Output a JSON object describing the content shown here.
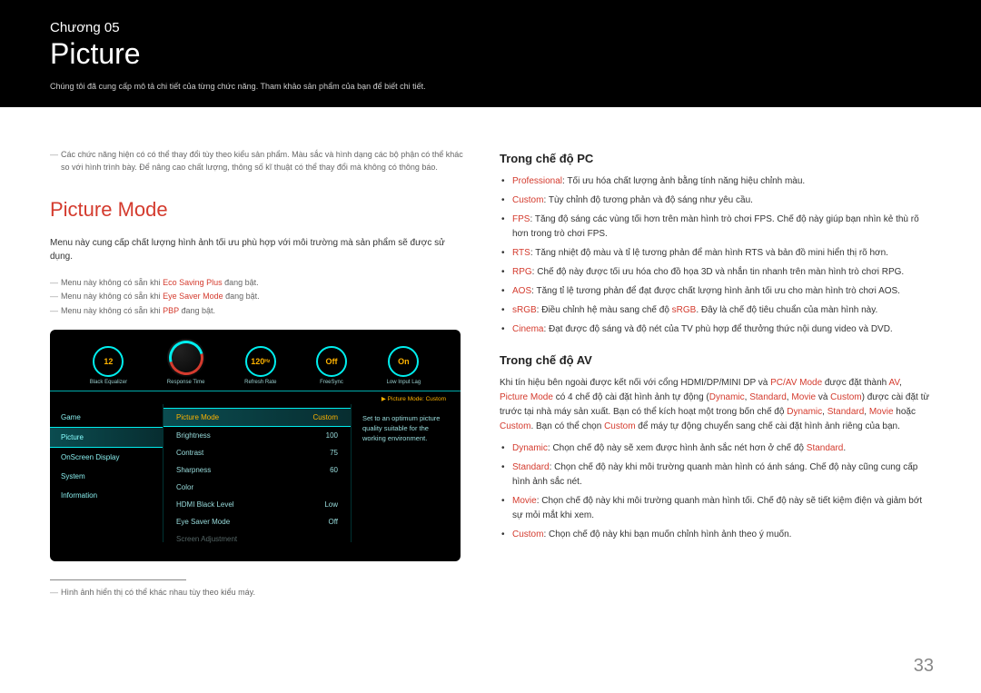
{
  "header": {
    "chapter": "Chương 05",
    "title": "Picture",
    "subtitle": "Chúng tôi đã cung cấp mô tả chi tiết của từng chức năng. Tham khảo sản phẩm của bạn để biết chi tiết."
  },
  "left": {
    "top_note_a": "Các chức năng hiện có có thể thay đổi tùy theo kiểu sản phẩm. Màu sắc và hình dạng các bộ phận có thể khác so với hình trình bày. Để nâng cao chất lượng, thông số kĩ thuật có thể thay đổi mà không có thông báo.",
    "section_title": "Picture Mode",
    "intro": "Menu này cung cấp chất lượng hình ảnh tối ưu phù hợp với môi trường mà sản phẩm sẽ được sử dụng.",
    "note1_a": "Menu này không có sẵn khi ",
    "note1_b": "Eco Saving Plus",
    "note1_c": " đang bật.",
    "note2_a": "Menu này không có sẵn khi ",
    "note2_b": "Eye Saver Mode",
    "note2_c": " đang bật.",
    "note3_a": "Menu này không có sẵn khi ",
    "note3_b": "PBP",
    "note3_c": " đang bật.",
    "footnote": "Hình ảnh hiển thị có thể khác nhau tùy theo kiểu máy."
  },
  "osd": {
    "gauges": [
      {
        "value": "12",
        "sub": "",
        "label": "Black Equalizer"
      },
      {
        "value": "",
        "sub": "",
        "label": "Response Time"
      },
      {
        "value": "120",
        "sub": "Hz",
        "label": "Refresh Rate"
      },
      {
        "value": "Off",
        "sub": "",
        "label": "FreeSync"
      },
      {
        "value": "On",
        "sub": "",
        "label": "Low Input Lag"
      }
    ],
    "modeline_prefix": "▶ Picture Mode: ",
    "modeline_value": "Custom",
    "nav": [
      {
        "label": "Game",
        "active": false
      },
      {
        "label": "Picture",
        "active": true
      },
      {
        "label": "OnScreen Display",
        "active": false
      },
      {
        "label": "System",
        "active": false
      },
      {
        "label": "Information",
        "active": false
      }
    ],
    "rows": [
      {
        "label": "Picture Mode",
        "value": "Custom",
        "active": true,
        "dim": false
      },
      {
        "label": "Brightness",
        "value": "100",
        "active": false,
        "dim": false
      },
      {
        "label": "Contrast",
        "value": "75",
        "active": false,
        "dim": false
      },
      {
        "label": "Sharpness",
        "value": "60",
        "active": false,
        "dim": false
      },
      {
        "label": "Color",
        "value": "",
        "active": false,
        "dim": false
      },
      {
        "label": "HDMI Black Level",
        "value": "Low",
        "active": false,
        "dim": false
      },
      {
        "label": "Eye Saver Mode",
        "value": "Off",
        "active": false,
        "dim": false
      },
      {
        "label": "Screen Adjustment",
        "value": "",
        "active": false,
        "dim": true
      }
    ],
    "desc": "Set to an optimum picture quality suitable for the working environment."
  },
  "right": {
    "pc_head": "Trong chế độ PC",
    "pc_items": [
      {
        "term": "Professional",
        "text": ": Tối ưu hóa chất lượng ảnh bằng tính năng hiệu chỉnh màu."
      },
      {
        "term": "Custom",
        "text": ": Tùy chỉnh độ tương phản và độ sáng như yêu cầu."
      },
      {
        "term": "FPS",
        "text": ": Tăng độ sáng các vùng tối hơn trên màn hình trò chơi FPS. Chế độ này giúp bạn nhìn kẻ thù rõ hơn trong trò chơi FPS."
      },
      {
        "term": "RTS",
        "text": ": Tăng nhiệt độ màu và tỉ lệ tương phản để màn hình RTS và bản đồ mini hiển thị rõ hơn."
      },
      {
        "term": "RPG",
        "text": ": Chế độ này được tối ưu hóa cho đồ họa 3D và nhắn tin nhanh trên màn hình trò chơi RPG."
      },
      {
        "term": "AOS",
        "text": ": Tăng tỉ lệ tương phản để đạt được chất lượng hình ảnh tối ưu cho màn hình trò chơi AOS."
      },
      {
        "term": "sRGB",
        "text_a": ": Điều chỉnh hệ màu sang chế độ ",
        "text_b": "sRGB",
        "text_c": ". Đây là chế độ tiêu chuẩn của màn hình này."
      },
      {
        "term": "Cinema",
        "text": ": Đạt được độ sáng và độ nét của TV phù hợp để thưởng thức nội dung video và DVD."
      }
    ],
    "av_head": "Trong chế độ AV",
    "av_para_parts": {
      "a": "Khi tín hiệu bên ngoài được kết nối với cổng HDMI/DP/MINI DP và ",
      "b": "PC/AV Mode",
      "c": " được đặt thành ",
      "d": "AV",
      "e": ", ",
      "f": "Picture Mode",
      "g": " có 4 chế độ cài đặt hình ảnh tự động (",
      "h": "Dynamic",
      "i": ", ",
      "j": "Standard",
      "k": ", ",
      "l": "Movie",
      "m": " và ",
      "n": "Custom",
      "o": ") được cài đặt từ trước tại nhà máy sản xuất. Bạn có thể kích hoạt một trong bốn chế độ ",
      "p": "Dynamic",
      "q": ", ",
      "r": "Standard",
      "s": ", ",
      "t": "Movie",
      "u": " hoặc ",
      "v": "Custom",
      "w": ". Bạn có thể chọn ",
      "x": "Custom",
      "y": " để máy tự động chuyển sang chế cài đặt hình ảnh riêng của bạn."
    },
    "av_items": [
      {
        "term": "Dynamic",
        "text_a": ": Chọn chế độ này sẽ xem được hình ảnh sắc nét hơn ở chế độ ",
        "text_b": "Standard",
        "text_c": "."
      },
      {
        "term": "Standard",
        "text": ": Chọn chế độ này khi môi trường quanh màn hình có ánh sáng. Chế độ này cũng cung cấp hình ảnh sắc nét."
      },
      {
        "term": "Movie",
        "text": ": Chọn chế độ này khi môi trường quanh màn hình tối. Chế độ này sẽ tiết kiệm điện và giảm bớt sự mỏi mắt khi xem."
      },
      {
        "term": "Custom",
        "text": ": Chọn chế độ này khi bạn muốn chỉnh hình ảnh theo ý muốn."
      }
    ]
  },
  "page_number": "33"
}
